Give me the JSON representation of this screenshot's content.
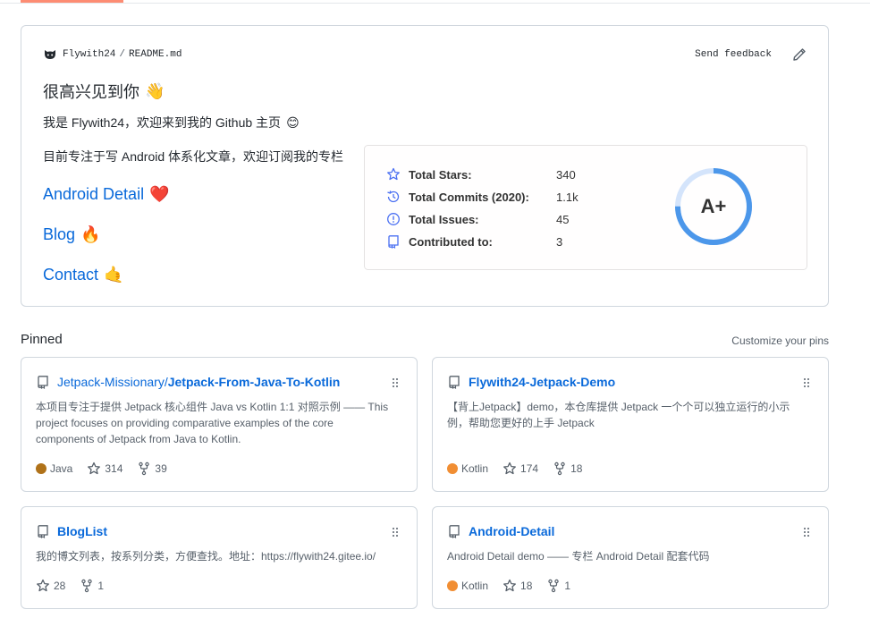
{
  "readme": {
    "user": "Flywith24",
    "separator": "/",
    "file": "README.md",
    "send_feedback": "Send feedback",
    "greeting": "很高兴见到你",
    "intro_prefix": "我是 Flywith24，欢迎来到我的 Github 主页",
    "focus": "目前专注于写 Android 体系化文章，欢迎订阅我的专栏",
    "links": [
      {
        "label": "Android Detail",
        "emoji": "❤️"
      },
      {
        "label": "Blog",
        "emoji": "🔥"
      },
      {
        "label": "Contact",
        "emoji": "🤙"
      }
    ],
    "wave_emoji": "👋",
    "smile_emoji": "😊"
  },
  "stats": {
    "rows": [
      {
        "label": "Total Stars:",
        "value": "340",
        "icon": "star-icon"
      },
      {
        "label": "Total Commits (2020):",
        "value": "1.1k",
        "icon": "history-icon"
      },
      {
        "label": "Total Issues:",
        "value": "45",
        "icon": "issue-icon"
      },
      {
        "label": "Contributed to:",
        "value": "3",
        "icon": "repo-icon"
      }
    ],
    "grade": "A+",
    "grade_progress": 0.75,
    "accent": "#4c97ea"
  },
  "pinned": {
    "title": "Pinned",
    "customize": "Customize your pins",
    "cards": [
      {
        "owner": "Jetpack-Missionary/",
        "name": "Jetpack-From-Java-To-Kotlin",
        "description": "本项目专注于提供 Jetpack 核心组件 Java vs Kotlin 1:1 对照示例 —— This project focuses on providing comparative examples of the core components of Jetpack from Java to Kotlin.",
        "language": "Java",
        "lang_color": "#b07219",
        "stars": "314",
        "forks": "39"
      },
      {
        "owner": "",
        "name": "Flywith24-Jetpack-Demo",
        "description": "【背上Jetpack】demo，本仓库提供 Jetpack 一个个可以独立运行的小示例，帮助您更好的上手 Jetpack",
        "language": "Kotlin",
        "lang_color": "#F18E33",
        "stars": "174",
        "forks": "18"
      },
      {
        "owner": "",
        "name": "BlogList",
        "description": "我的博文列表，按系列分类，方便查找。地址：https://flywith24.gitee.io/",
        "language": "",
        "lang_color": "",
        "stars": "28",
        "forks": "1"
      },
      {
        "owner": "",
        "name": "Android-Detail",
        "description": "Android Detail demo —— 专栏 Android Detail 配套代码",
        "language": "Kotlin",
        "lang_color": "#F18E33",
        "stars": "18",
        "forks": "1"
      }
    ]
  }
}
